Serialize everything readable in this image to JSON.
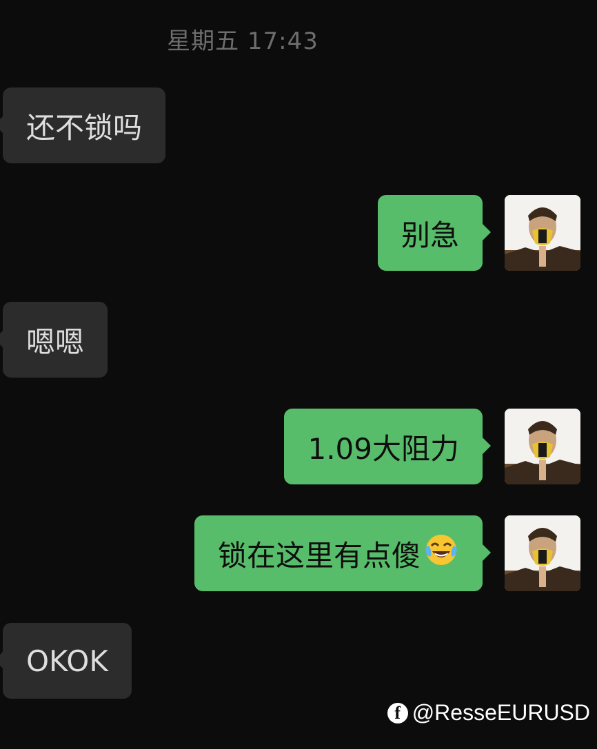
{
  "chat": {
    "timestamp": "星期五 17:43",
    "messages": [
      {
        "direction": "in",
        "text": "还不锁吗"
      },
      {
        "direction": "out",
        "text": "别急"
      },
      {
        "direction": "in",
        "text": "嗯嗯"
      },
      {
        "direction": "out",
        "text": "1.09大阻力"
      },
      {
        "direction": "out",
        "text": "锁在这里有点傻",
        "emoji": "laughing-tears-emoji"
      },
      {
        "direction": "in",
        "text": "OKOK"
      }
    ]
  },
  "watermark": {
    "icon": "facebook-icon",
    "handle": "@ResseEURUSD"
  },
  "colors": {
    "background": "#0c0c0c",
    "incoming_bubble": "#2c2c2c",
    "outgoing_bubble": "#58bd6a",
    "timestamp_text": "#6e6e6e"
  }
}
